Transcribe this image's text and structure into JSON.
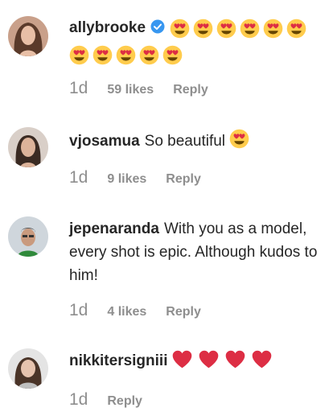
{
  "comments": [
    {
      "username": "allybrooke",
      "verified": true,
      "text": "",
      "emoji": [
        "heart-eyes-emoji",
        "heart-eyes-emoji",
        "heart-eyes-emoji",
        "heart-eyes-emoji",
        "heart-eyes-emoji",
        "heart-eyes-emoji",
        "heart-eyes-emoji",
        "heart-eyes-emoji",
        "heart-eyes-emoji",
        "heart-eyes-emoji",
        "heart-eyes-emoji"
      ],
      "time": "1d",
      "likes": "59 likes",
      "reply": "Reply"
    },
    {
      "username": "vjosamua",
      "verified": false,
      "text": "So beautiful",
      "emoji": [
        "heart-eyes-emoji"
      ],
      "time": "1d",
      "likes": "9 likes",
      "reply": "Reply"
    },
    {
      "username": "jepenaranda",
      "verified": false,
      "text": "With you as a model, every shot is epic. Although kudos to him!",
      "emoji": [],
      "time": "1d",
      "likes": "4 likes",
      "reply": "Reply"
    },
    {
      "username": "nikkitersigniii",
      "verified": false,
      "text": "",
      "emoji": [
        "red-heart-emoji",
        "red-heart-emoji",
        "red-heart-emoji",
        "red-heart-emoji"
      ],
      "time": "1d",
      "likes": "",
      "reply": "Reply"
    }
  ],
  "colors": {
    "text": "#262626",
    "muted": "#8e8e8e",
    "verified_blue": "#3897f0",
    "emoji_yellow": "#ffcc4d",
    "heart_red": "#dd2e44"
  }
}
